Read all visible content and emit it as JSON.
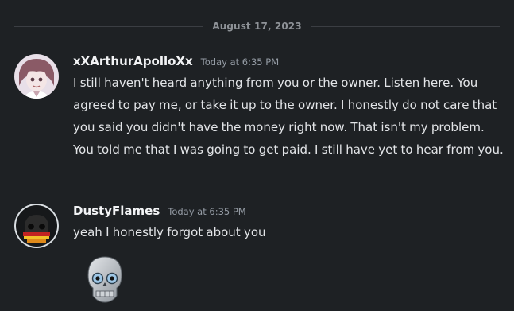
{
  "date_divider": "August 17, 2023",
  "messages": [
    {
      "username": "xXArthurApolloXx",
      "timestamp": "Today at 6:35 PM",
      "text": "I still haven't heard anything from you or the owner. Listen here. You agreed to pay me, or take it up to the owner. I honestly do not care that you said you didn't have the money right now. That isn't my problem. You told me that I was going to get paid. I still have yet to hear from you.",
      "avatar_icon": "anime-character-avatar"
    },
    {
      "username": "DustyFlames",
      "timestamp": "Today at 6:35 PM",
      "text": "yeah I honestly forgot about you",
      "avatar_icon": "skull-avatar",
      "attachment_icon": "skull-sticker"
    }
  ],
  "colors": {
    "background": "#1e2124",
    "username": "#f2f3f5",
    "text": "#e3e5e8",
    "timestamp": "#949ba4",
    "divider_line": "#3b3e43"
  }
}
